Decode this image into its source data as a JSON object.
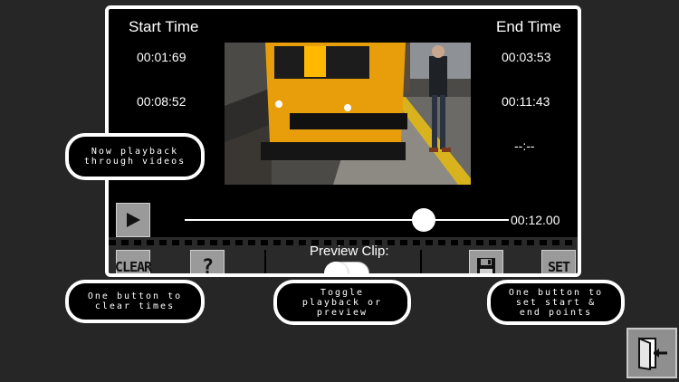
{
  "start": {
    "label": "Start Time",
    "times": [
      "00:01:69",
      "00:08:52"
    ]
  },
  "end": {
    "label": "End Time",
    "times": [
      "00:03:53",
      "00:11:43",
      "--:--"
    ]
  },
  "slider": {
    "time": "00:12.00",
    "progress": 0.72
  },
  "controls": {
    "clear_label": "CLEAR",
    "help_label": "?",
    "set_label": "SET",
    "preview_label": "Preview Clip:",
    "preview_toggle_on": false
  },
  "tips": {
    "playback": "Now playback\nthrough videos",
    "clear": "One button to\nclear times",
    "toggle": "Toggle\nplayback or\npreview",
    "set": "One button to\nset start &\nend points"
  },
  "icons": [
    "play-icon",
    "help-icon",
    "save-icon",
    "exit-door-icon"
  ],
  "colors": {
    "background": "#262626",
    "panel": "#000000",
    "button": "#9a9a9a",
    "train_yellow": "#f0a500"
  }
}
